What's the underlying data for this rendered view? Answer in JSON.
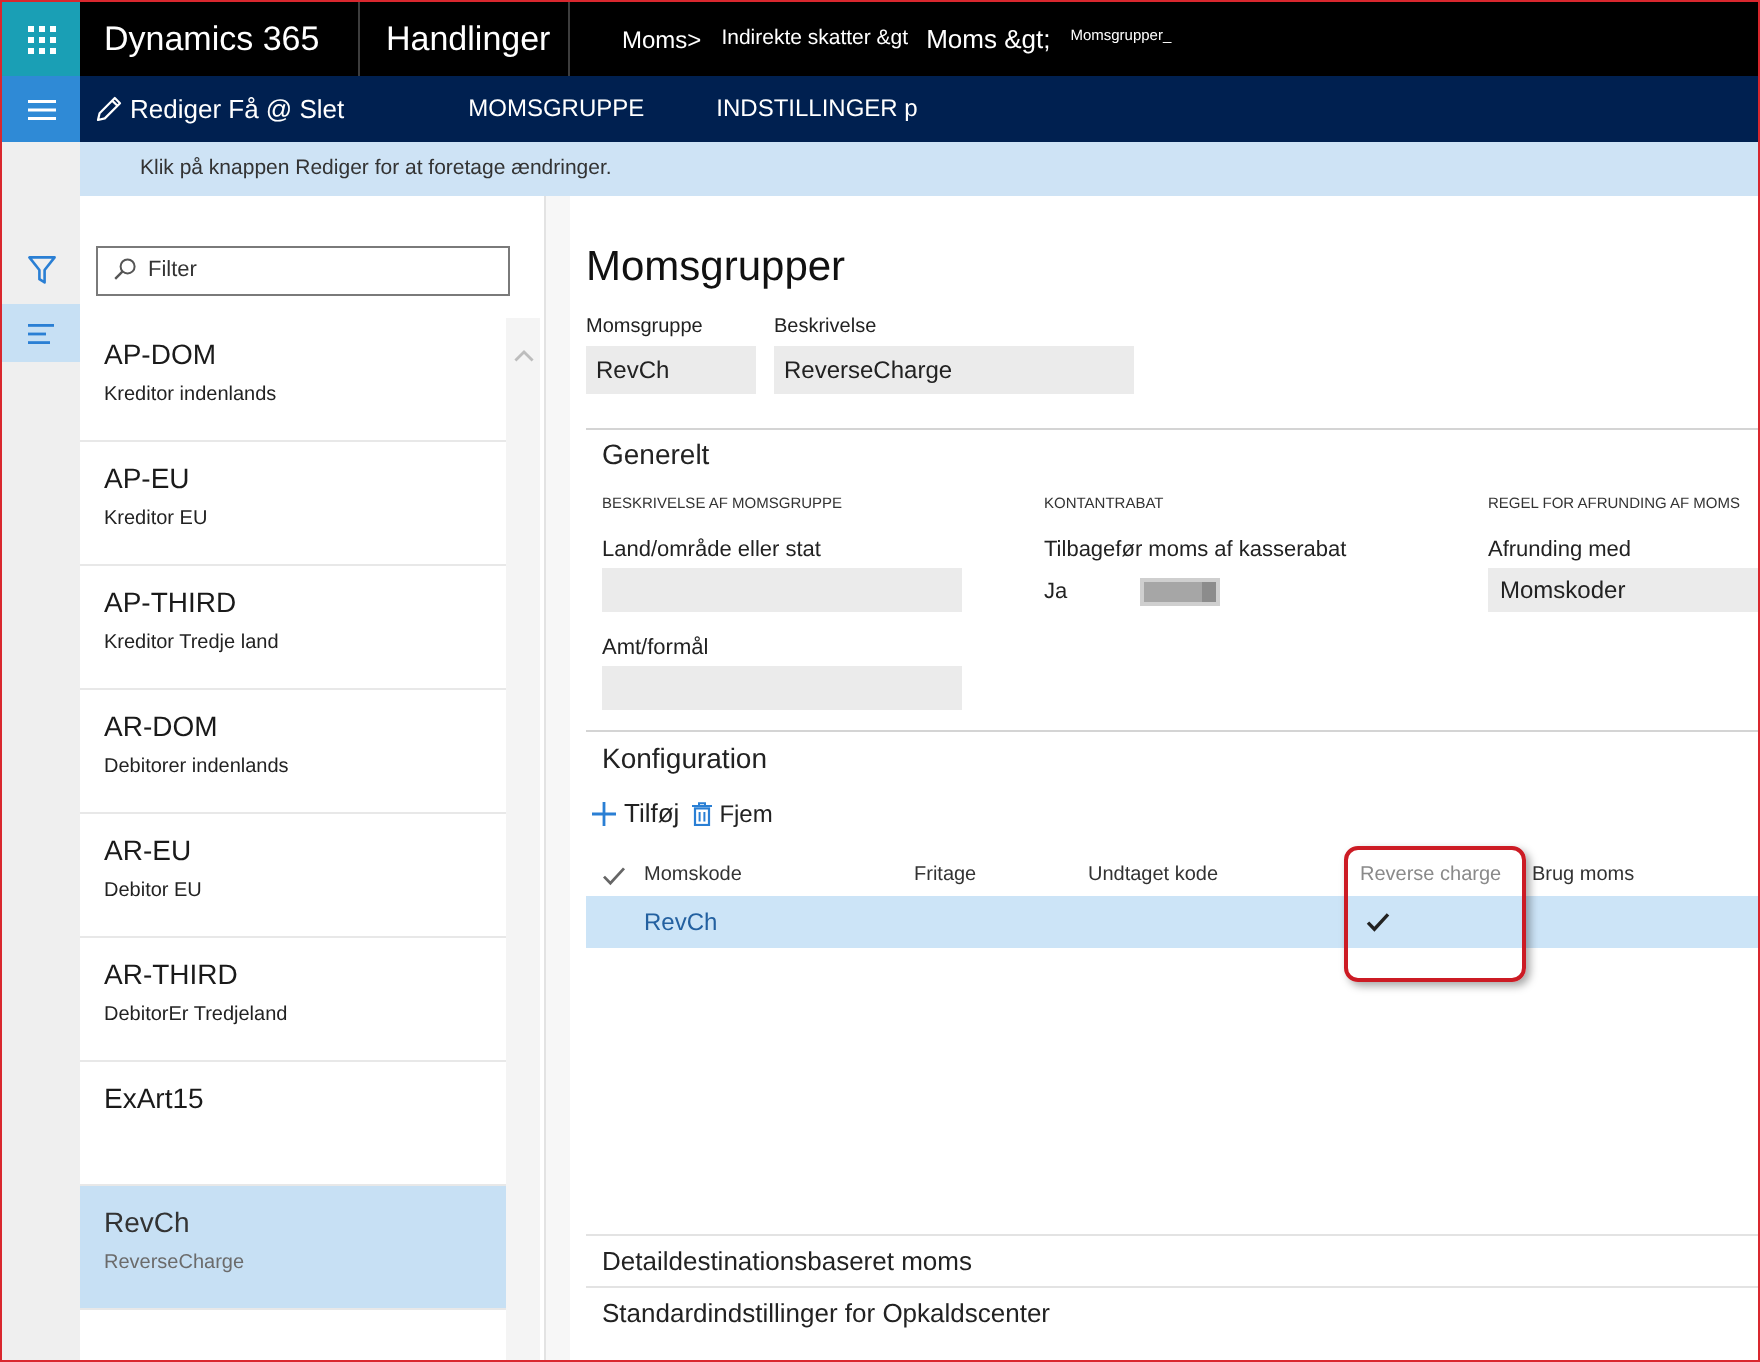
{
  "app_bar": {
    "app_name": "Dynamics 365",
    "module": "Handlinger",
    "breadcrumb": [
      "Moms>",
      "Indirekte skatter &gt",
      "Moms &gt;",
      "Momsgrupper_"
    ]
  },
  "action_bar": {
    "edit_label": "Rediger Få @ Slet",
    "menu_items": [
      "MOMSGRUPPE",
      "INDSTILLINGER p"
    ]
  },
  "info_message": "Klik på knappen Rediger for at foretage ændringer.",
  "nav_rail": [
    {
      "kind": "filter",
      "selected": false
    },
    {
      "kind": "list",
      "selected": true
    }
  ],
  "list_panel": {
    "search": {
      "placeholder": "Filter"
    },
    "items": [
      {
        "code": "AP-DOM",
        "description": "Kreditor indenlands",
        "selected": false
      },
      {
        "code": "AP-EU",
        "description": "Kreditor EU",
        "selected": false
      },
      {
        "code": "AP-THIRD",
        "description": "Kreditor Tredje land",
        "selected": false
      },
      {
        "code": "AR-DOM",
        "description": "Debitorer indenlands",
        "selected": false
      },
      {
        "code": "AR-EU",
        "description": "Debitor EU",
        "selected": false
      },
      {
        "code": "AR-THIRD",
        "description": "DebitorEr Tredjeland",
        "selected": false
      },
      {
        "code": "ExArt15",
        "selected": false
      },
      {
        "code": "RevCh",
        "description": "ReverseCharge",
        "selected": true
      }
    ]
  },
  "form": {
    "title": "Momsgrupper",
    "header_fields": [
      {
        "label": "Momsgruppe",
        "value": "RevCh"
      },
      {
        "label": "Beskrivelse",
        "value": "ReverseCharge"
      }
    ],
    "general": {
      "title": "Generelt",
      "groups": [
        {
          "heading": "BESKRIVELSE AF MOMSGRUPPE",
          "fields": [
            {
              "kind": "text",
              "label": "Land/område eller stat"
            },
            {
              "kind": "text",
              "label": "Amt/formål"
            }
          ]
        },
        {
          "heading": "KONTANTRABAT",
          "fields": [
            {
              "kind": "toggle",
              "label": "Tilbagefør moms af kasserabat",
              "value": "Ja",
              "on": true
            }
          ]
        },
        {
          "heading": "REGEL FOR AFRUNDING AF MOMS",
          "fields": [
            {
              "kind": "text",
              "label": "Afrunding med",
              "value": "Momskoder"
            }
          ]
        }
      ]
    },
    "configuration": {
      "title": "Konfiguration",
      "actions": [
        {
          "kind": "add",
          "label": "Tilføj"
        },
        {
          "kind": "delete",
          "label": "Fjem"
        }
      ],
      "grid": {
        "columns": [
          {
            "label": "Momskode",
            "highlighted": false
          },
          {
            "label": "Fritage",
            "highlighted": false
          },
          {
            "label": "Undtaget kode",
            "highlighted": false
          },
          {
            "label": "Reverse charge",
            "highlighted": true
          },
          {
            "label": "Brug moms",
            "highlighted": false
          }
        ],
        "rows": [
          {
            "selected": true,
            "momskode": "RevCh",
            "reverse_charge": true
          }
        ]
      }
    },
    "collapsed_sections": [
      "Detaildestinationsbaseret moms",
      "Standardindstillinger for Opkaldscenter"
    ]
  }
}
